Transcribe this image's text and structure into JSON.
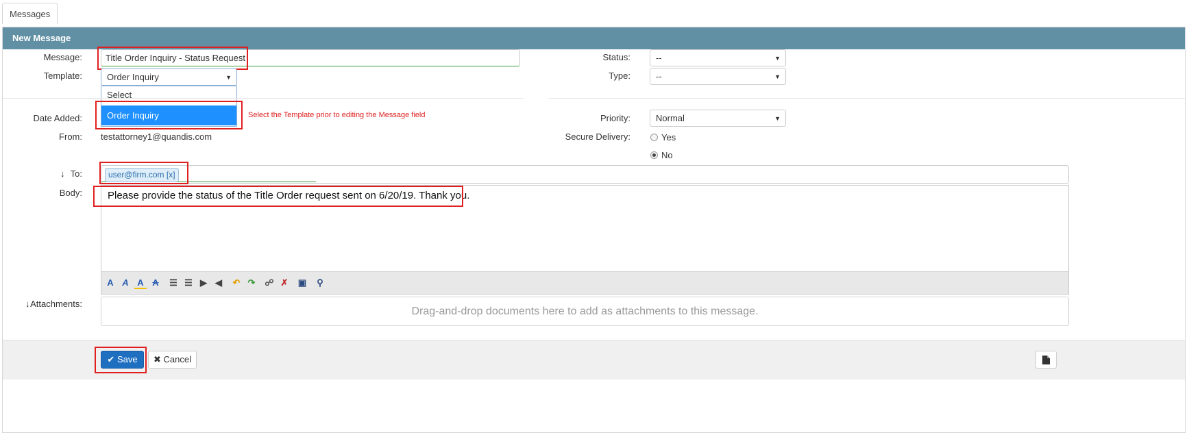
{
  "tab": {
    "label": "Messages"
  },
  "panel": {
    "title": "New Message"
  },
  "form": {
    "message_label": "Message:",
    "message_value": "Title Order Inquiry - Status Request",
    "template_label": "Template:",
    "template_value": "Order Inquiry",
    "template_options": [
      "Select",
      "Order Inquiry"
    ],
    "template_hint": "Select the Template prior to editing the Message field",
    "date_added_label": "Date Added:",
    "from_label": "From:",
    "from_value": "testattorney1@quandis.com",
    "to_label": "To:",
    "to_token": "user@firm.com [x]",
    "body_label": "Body:",
    "body_text": "Please provide the status of the Title Order request sent on 6/20/19.  Thank you.",
    "attachments_label": "Attachments:",
    "attachments_hint": "Drag-and-drop documents here to add as attachments to this message."
  },
  "right": {
    "status_label": "Status:",
    "status_value": "--",
    "type_label": "Type:",
    "type_value": "--",
    "priority_label": "Priority:",
    "priority_value": "Normal",
    "secure_label": "Secure Delivery:",
    "secure_yes": "Yes",
    "secure_no": "No",
    "secure_selected": "No"
  },
  "icons": {
    "arrow_down": "↓",
    "check": "✔",
    "times": "✖",
    "document": "document-icon",
    "toolbar": [
      "font-color-icon",
      "font-italic-icon",
      "highlight-icon",
      "strikethrough-icon",
      "bullet-list-icon",
      "numbered-list-icon",
      "indent-icon",
      "outdent-icon",
      "undo-icon",
      "redo-icon",
      "insert-link-icon",
      "remove-link-icon",
      "insert-image-icon",
      "find-icon"
    ]
  },
  "footer": {
    "save_label": "Save",
    "cancel_label": "Cancel"
  },
  "colors": {
    "header": "#6190a4",
    "primary_button": "#1e6fc0",
    "highlight": "#e02020",
    "selected_option": "#1e90ff"
  }
}
